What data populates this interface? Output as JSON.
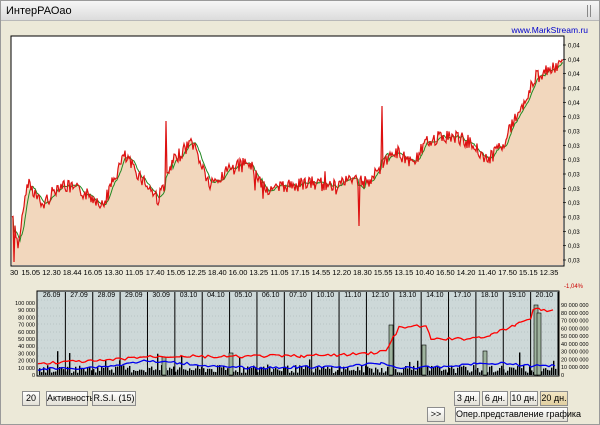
{
  "window": {
    "title": "ИнтерРАОао",
    "watermark": "www.MarkStream.ru"
  },
  "colors": {
    "price_line": "#dd1111",
    "ma_line": "#228822",
    "price_fill": "#f2d7bd",
    "volume_red": "#ff0000",
    "volume_blue": "#0000ee",
    "panel_bg": "#cdd8d8",
    "link": "#0000cc"
  },
  "price_axis": {
    "tick_labels": [
      "0,04",
      "0,04",
      "0,04",
      "0,04",
      "0,04",
      "0,03",
      "0,03",
      "0,03",
      "0,03",
      "0,03",
      "0,03",
      "0,03",
      "0,03",
      "0,03",
      "0,03",
      "0,03"
    ]
  },
  "time_axis": {
    "labels": [
      "30",
      "15.05",
      "12.30",
      "18.44",
      "16.05",
      "13.30",
      "11.05",
      "17.40",
      "15.05",
      "12.25",
      "18.40",
      "16.00",
      "13.25",
      "11.05",
      "17.15",
      "14.55",
      "12.20",
      "18.30",
      "15.55",
      "13.15",
      "10.40",
      "16.50",
      "14.20",
      "11.40",
      "17.50",
      "15.15",
      "12.35"
    ]
  },
  "change_badge": "-1,04%",
  "volume_panel": {
    "dates": [
      "26.09",
      "27.09",
      "28.09",
      "29.09",
      "30.09",
      "03.10",
      "04.10",
      "05.10",
      "06.10",
      "07.10",
      "10.10",
      "11.10",
      "12.10",
      "13.10",
      "14.10",
      "17.10",
      "18.10",
      "19.10",
      "20.10"
    ],
    "left_axis": [
      "100 000",
      "90 000",
      "80 000",
      "70 000",
      "60 000",
      "50 000",
      "40 000",
      "30 000",
      "20 000",
      "10 000",
      "0"
    ],
    "right_axis": [
      "90 000 000",
      "80 000 000",
      "70 000 000",
      "60 000 000",
      "50 000 000",
      "40 000 000",
      "30 000 000",
      "20 000 000",
      "10 000 000",
      "0"
    ]
  },
  "toolbar": {
    "period_value": "20",
    "activity_label": "Активность",
    "rsi_label": "R.S.I. (15)",
    "btn_3d": "3 дн.",
    "btn_6d": "6 дн.",
    "btn_10d": "10 дн.",
    "btn_20d": "20 дн.",
    "selected_period": "20 дн.",
    "scroll_label": ">>",
    "oper_label": "Опер.представление графика"
  }
}
